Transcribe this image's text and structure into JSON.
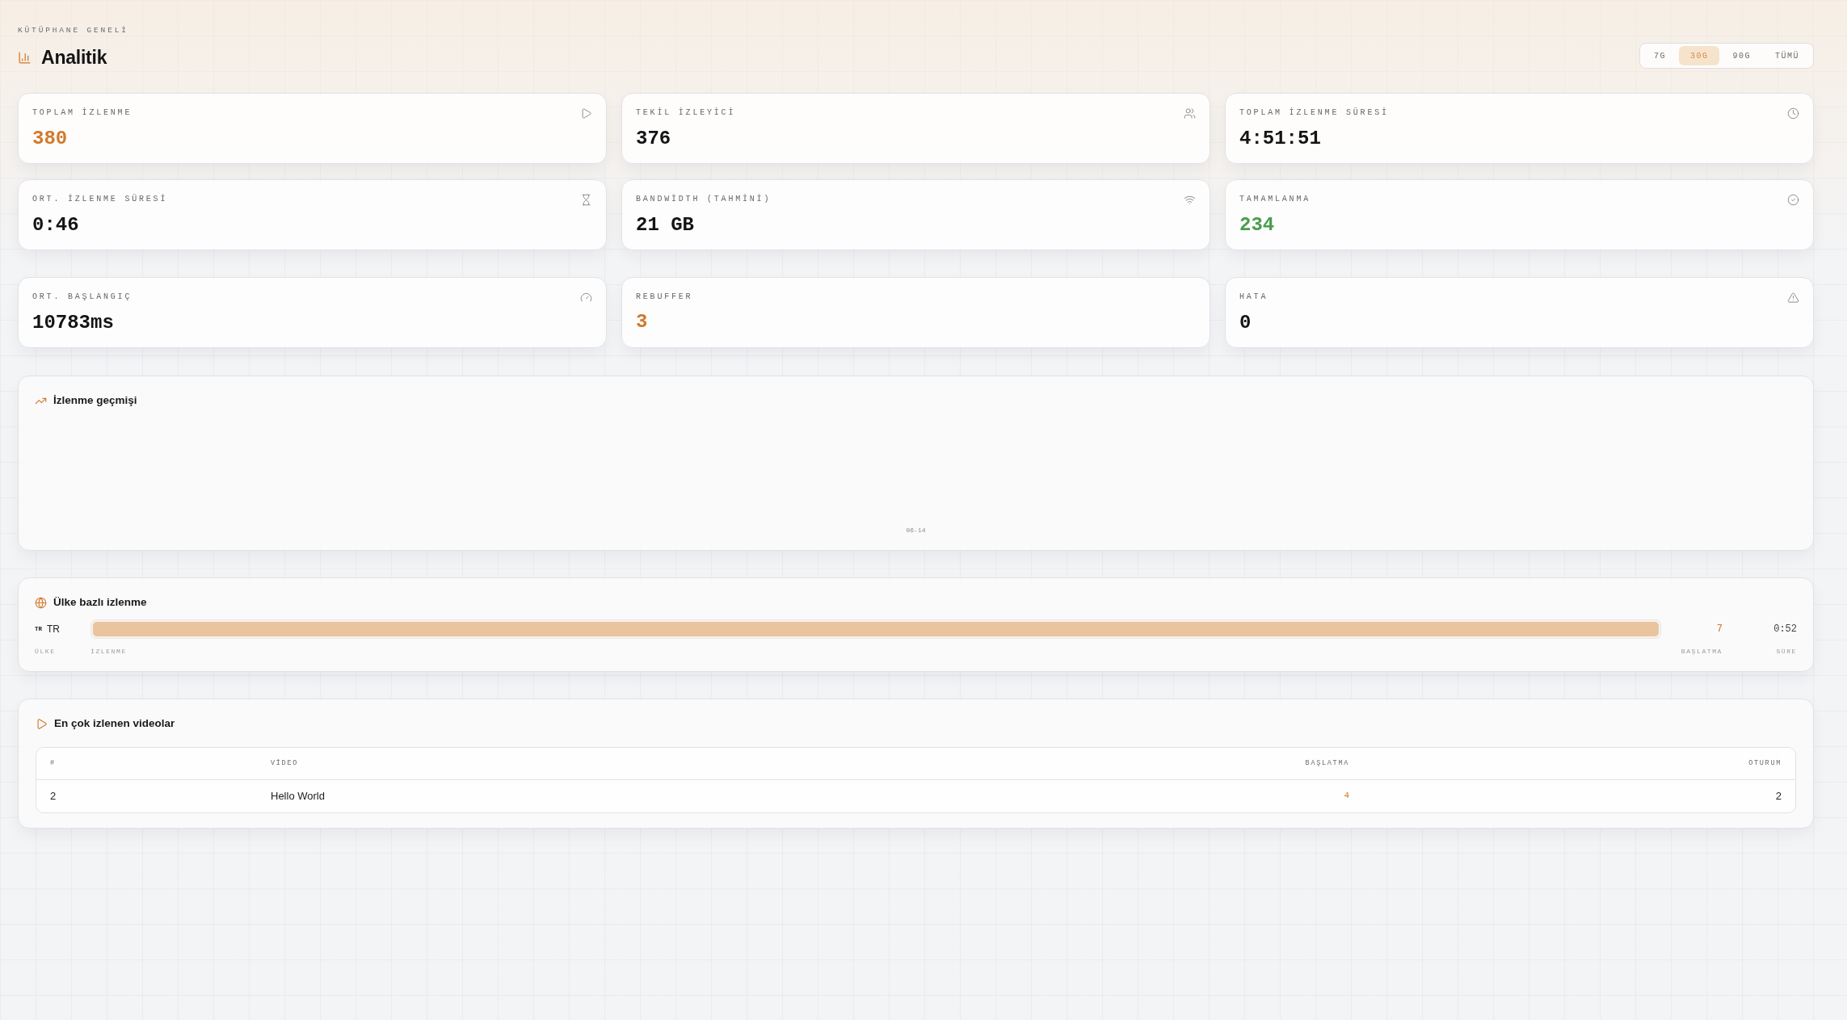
{
  "header": {
    "eyebrow": "KÜTÜPHANE GENELİ",
    "title": "Analitik"
  },
  "range_tabs": [
    {
      "label": "7G",
      "selected": false
    },
    {
      "label": "30G",
      "selected": true
    },
    {
      "label": "90G",
      "selected": false
    },
    {
      "label": "TÜMÜ",
      "selected": false
    }
  ],
  "summary_cards": [
    {
      "label": "TOPLAM İZLENME",
      "value": "380",
      "color": "#d2792b"
    },
    {
      "label": "TEKİL İZLEYİCİ",
      "value": "376",
      "color": "#141414"
    },
    {
      "label": "TOPLAM İZLENME SÜRESİ",
      "value": "4:51:51",
      "color": "#141414"
    },
    {
      "label": "ORT. İZLENME SÜRESİ",
      "value": "0:46",
      "color": "#141414"
    },
    {
      "label": "BANDWİDTH (TAHMİNİ)",
      "value": "21 GB",
      "color": "#141414"
    },
    {
      "label": "TAMAMLANMA",
      "value": "234",
      "color": "#4a9d4f"
    }
  ],
  "quality_cards": [
    {
      "label": "ORT. BAŞLANGIÇ",
      "value": "10783ms",
      "color": "#141414"
    },
    {
      "label": "REBUFFER",
      "value": "3",
      "color": "#d2792b"
    },
    {
      "label": "HATA",
      "value": "0",
      "color": "#141414"
    }
  ],
  "history_panel": {
    "title": "İzlenme geçmişi",
    "x_axis_labels": [
      "06-14"
    ]
  },
  "country_panel": {
    "title": "Ülke bazlı izlenme",
    "rows": [
      {
        "code": "TR",
        "name": "TR",
        "level": 1,
        "starts": "7",
        "duration": "0:52"
      }
    ],
    "footer": [
      "ÜLKE",
      "İZLENME",
      "BAŞLATMA",
      "SÜRE"
    ]
  },
  "top_videos": {
    "title": "En çok izlenen videolar",
    "columns": [
      "#",
      "VİDEO",
      "BAŞLATMA",
      "OTURUM"
    ],
    "rows": [
      [
        "2",
        "Hello World",
        "4",
        "2"
      ]
    ]
  }
}
